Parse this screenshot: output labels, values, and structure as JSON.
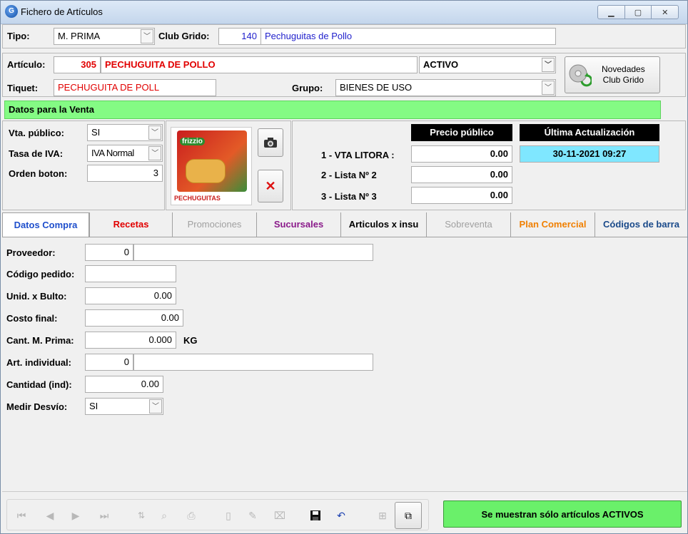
{
  "window": {
    "title": "Fichero de Artículos"
  },
  "header": {
    "tipo_label": "Tipo:",
    "tipo_value": "M. PRIMA",
    "club_label": "Club Grido:",
    "club_code": "140",
    "club_name": "Pechuguitas de Pollo"
  },
  "article": {
    "articulo_label": "Artículo:",
    "code": "305",
    "name": "PECHUGUITA DE POLLO",
    "status": "ACTIVO",
    "tiquet_label": "Tiquet:",
    "tiquet": "PECHUGUITA DE POLL",
    "grupo_label": "Grupo:",
    "grupo": "BIENES DE USO",
    "novedades_line1": "Novedades",
    "novedades_line2": "Club Grido"
  },
  "venta": {
    "section_title": "Datos para la Venta",
    "vta_label": "Vta. público:",
    "vta_value": "SI",
    "iva_label": "Tasa de IVA:",
    "iva_value": "IVA Normal",
    "orden_label": "Orden boton:",
    "orden_value": "3",
    "product_image_text": "PECHUGUITAS",
    "product_brand": "frizzio",
    "precio_header": "Precio público",
    "actualizacion_header": "Última Actualización",
    "actualizacion_value": "30-11-2021 09:27",
    "price_lists": [
      {
        "label": "1 - VTA LITORA :",
        "value": "0.00"
      },
      {
        "label": "2 - Lista Nº 2",
        "value": "0.00"
      },
      {
        "label": "3 - Lista Nº 3",
        "value": "0.00"
      }
    ]
  },
  "tabs": [
    {
      "label": "Datos Compra",
      "color": "#1f4fcc"
    },
    {
      "label": "Recetas",
      "color": "#e10000"
    },
    {
      "label": "Promociones",
      "color": "#a0a0a0"
    },
    {
      "label": "Sucursales",
      "color": "#8a1a8a"
    },
    {
      "label": "Articulos x insu",
      "color": "#000000"
    },
    {
      "label": "Sobreventa",
      "color": "#a0a0a0"
    },
    {
      "label": "Plan Comercial",
      "color": "#f07f00"
    },
    {
      "label": "Códigos de barra",
      "color": "#1a4a8a"
    }
  ],
  "compra": {
    "proveedor_label": "Proveedor:",
    "proveedor_code": "0",
    "proveedor_name": "",
    "codigo_pedido_label": "Código pedido:",
    "codigo_pedido": "",
    "unid_bulto_label": "Unid. x Bulto:",
    "unid_bulto": "0.00",
    "costo_final_label": "Costo final:",
    "costo_final": "0.00",
    "cant_mprima_label": "Cant. M. Prima:",
    "cant_mprima": "0.000",
    "cant_mprima_unit": "KG",
    "art_individual_label": "Art. individual:",
    "art_individual_code": "0",
    "art_individual_name": "",
    "cantidad_ind_label": "Cantidad (ind):",
    "cantidad_ind": "0.00",
    "medir_desvio_label": "Medir Desvío:",
    "medir_desvio": "SI"
  },
  "footer": {
    "status_button": "Se muestran sólo artículos ACTIVOS"
  }
}
